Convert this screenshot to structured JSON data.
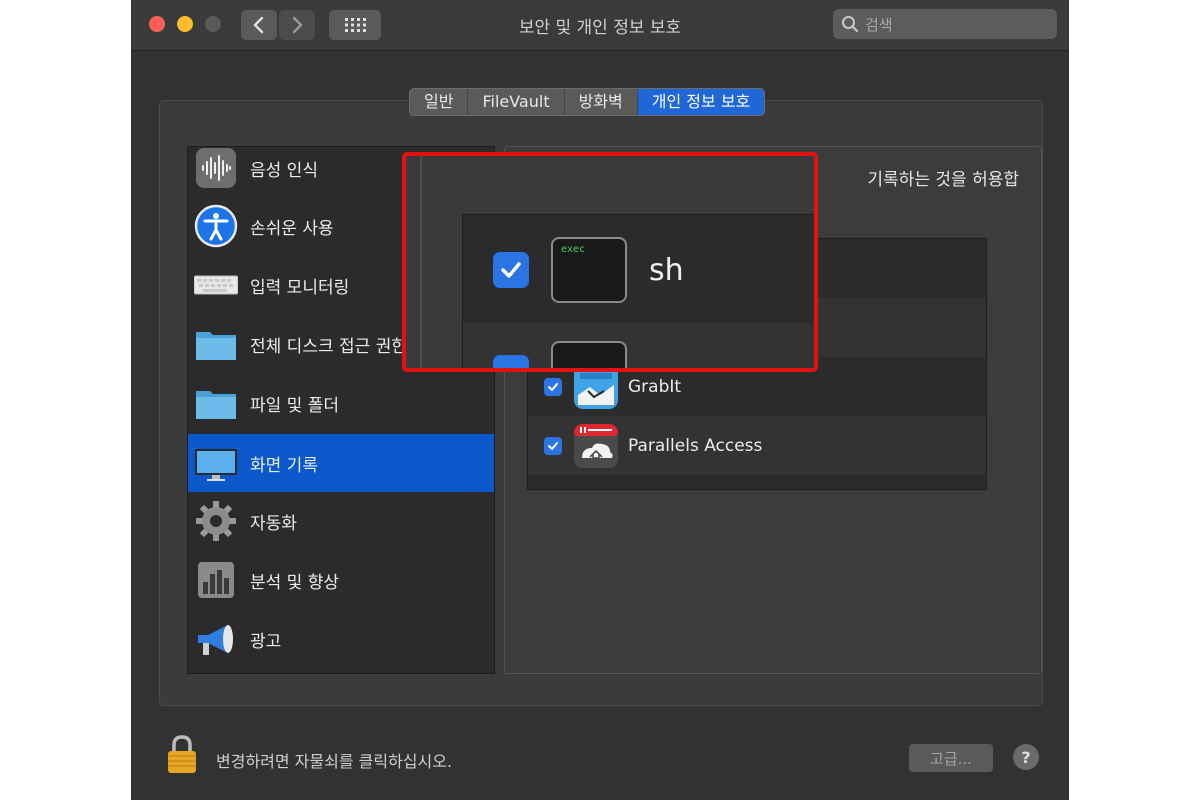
{
  "window": {
    "title": "보안 및 개인 정보 보호",
    "search_placeholder": "검색"
  },
  "tabs": [
    {
      "label": "일반",
      "active": false
    },
    {
      "label": "FileVault",
      "active": false
    },
    {
      "label": "방화벽",
      "active": false
    },
    {
      "label": "개인 정보 보호",
      "active": true
    }
  ],
  "sidebar": {
    "items": [
      {
        "label": "음성 인식",
        "icon": "waveform-icon",
        "selected": false
      },
      {
        "label": "손쉬운 사용",
        "icon": "accessibility-icon",
        "selected": false
      },
      {
        "label": "입력 모니터링",
        "icon": "keyboard-icon",
        "selected": false
      },
      {
        "label": "전체 디스크 접근 권한",
        "icon": "folder-icon",
        "selected": false
      },
      {
        "label": "파일 및 폴더",
        "icon": "folder-icon",
        "selected": false
      },
      {
        "label": "화면 기록",
        "icon": "display-icon",
        "selected": true
      },
      {
        "label": "자동화",
        "icon": "gear-icon",
        "selected": false
      },
      {
        "label": "분석 및 향상",
        "icon": "chart-icon",
        "selected": false
      },
      {
        "label": "광고",
        "icon": "megaphone-icon",
        "selected": false
      }
    ]
  },
  "panel": {
    "description": "기록하는 것을 허용합",
    "apps": [
      {
        "name": "sh",
        "checked": true,
        "icon": "terminal-icon"
      },
      {
        "name": "",
        "checked": true,
        "icon": "terminal-icon"
      },
      {
        "name": "GrabIt",
        "checked": true,
        "icon": "grabit-icon"
      },
      {
        "name": "Parallels Access",
        "checked": true,
        "icon": "parallels-icon"
      }
    ]
  },
  "zoom_callout": {
    "app_name": "sh",
    "terminal_label": "exec",
    "highlight_color": "#e31212"
  },
  "footer": {
    "lock_text": "변경하려면 자물쇠를 클릭하십시오.",
    "advanced_label": "고급...",
    "help_label": "?"
  },
  "colors": {
    "accent": "#0a58ca",
    "checkbox": "#2a74e6"
  }
}
